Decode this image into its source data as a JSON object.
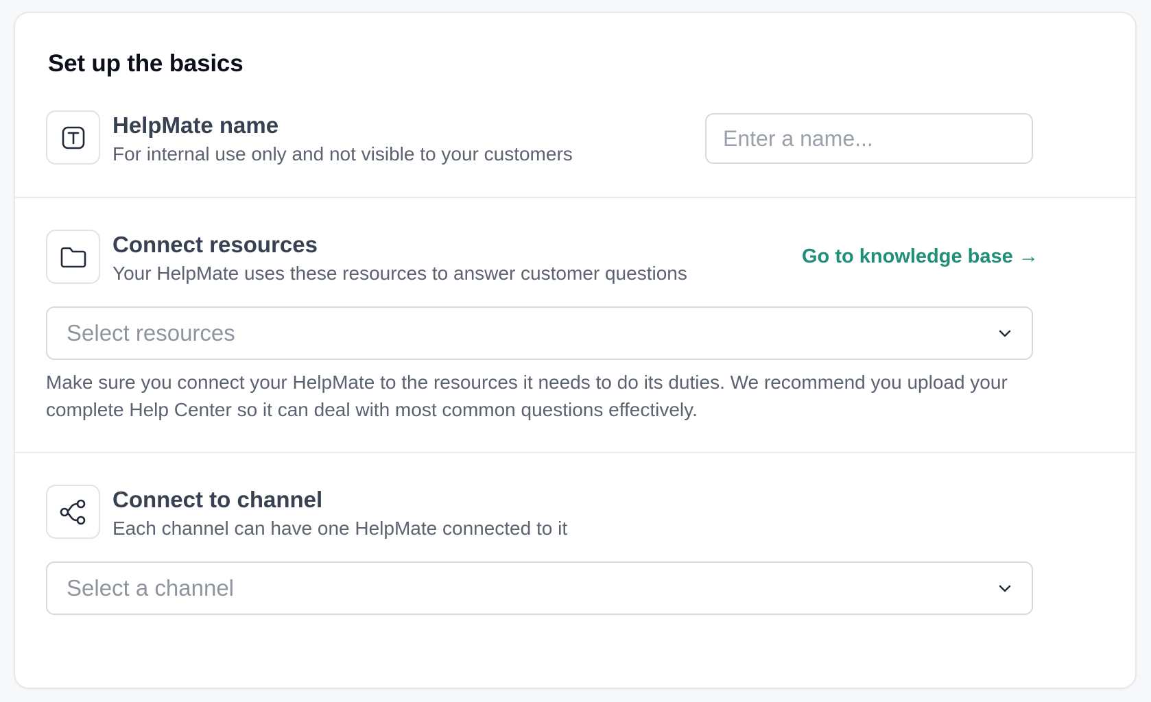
{
  "card": {
    "title": "Set up the basics"
  },
  "name_section": {
    "icon": "text-box-icon",
    "title": "HelpMate name",
    "description": "For internal use only and not visible to your customers",
    "input_placeholder": "Enter a name...",
    "input_value": ""
  },
  "resources_section": {
    "icon": "folder-icon",
    "title": "Connect resources",
    "description": "Your HelpMate uses these resources to answer customer questions",
    "link_label": "Go to knowledge base →",
    "select_placeholder": "Select resources",
    "help_text": "Make sure you connect your HelpMate to the resources it needs to do its duties. We recommend you upload your complete Help Center so it can deal with most common questions effectively."
  },
  "channel_section": {
    "icon": "share-nodes-icon",
    "title": "Connect to channel",
    "description": "Each channel can have one HelpMate connected to it",
    "select_placeholder": "Select a channel"
  },
  "colors": {
    "accent_link": "#1f8f7a",
    "title_text": "#0b0f19",
    "muted_text": "#5b6370",
    "border": "#d6d9de"
  }
}
